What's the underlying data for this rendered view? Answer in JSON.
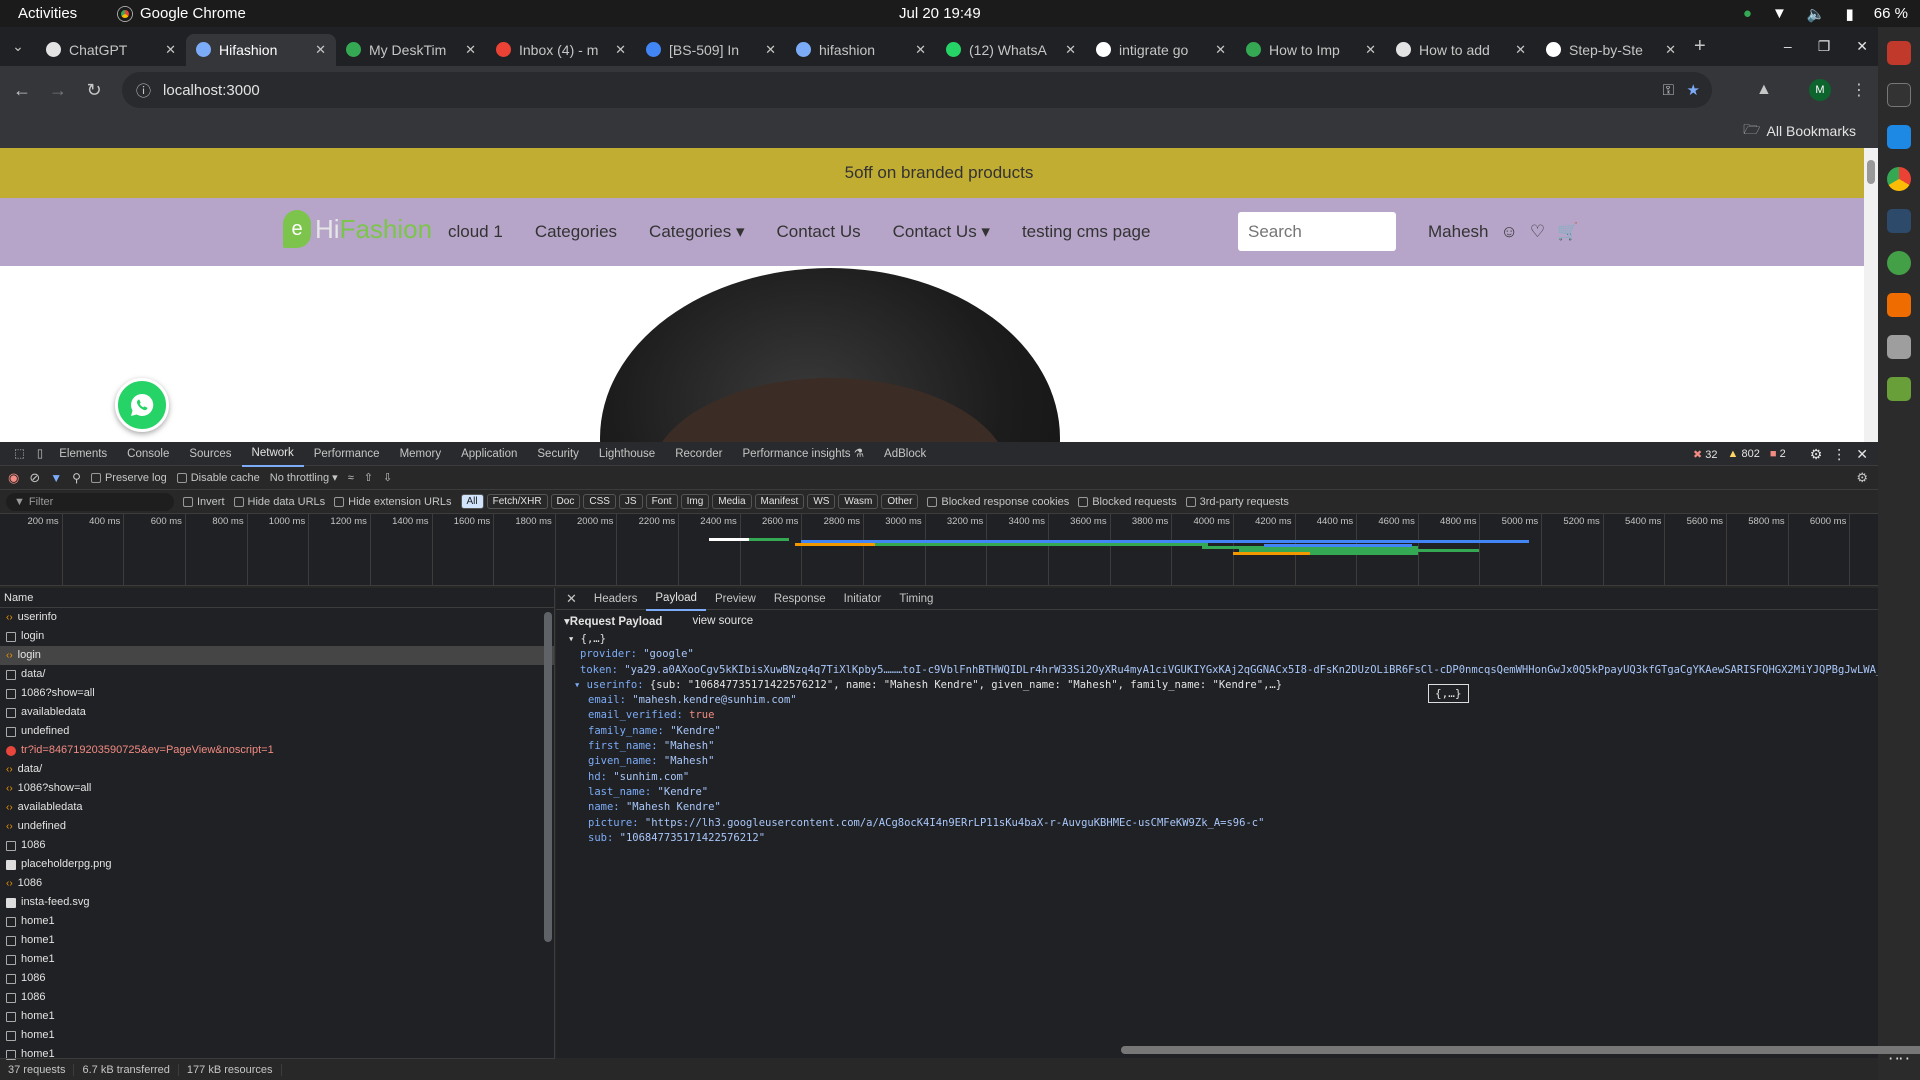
{
  "os": {
    "activities": "Activities",
    "app_name": "Google Chrome",
    "clock": "Jul 20  19:49",
    "battery": "66 %"
  },
  "tabs": [
    {
      "title": "ChatGPT",
      "color": "#e3e3e3"
    },
    {
      "title": "Hifashion",
      "color": "#7cacf8",
      "active": true
    },
    {
      "title": "My DeskTim",
      "color": "#34a853"
    },
    {
      "title": "Inbox (4) - m",
      "color": "#ea4335"
    },
    {
      "title": "[BS-509] In",
      "color": "#4285f4"
    },
    {
      "title": "hifashion",
      "color": "#7cacf8"
    },
    {
      "title": "(12) WhatsA",
      "color": "#25d366"
    },
    {
      "title": "intigrate go",
      "color": "#ffffff"
    },
    {
      "title": "How to Imp",
      "color": "#34a853"
    },
    {
      "title": "How to add",
      "color": "#e3e3e3"
    },
    {
      "title": "Step-by-Ste",
      "color": "#ffffff"
    }
  ],
  "url": "localhost:3000",
  "bookmarks_label": "All Bookmarks",
  "profile_initial": "M",
  "site": {
    "promo": "5off on branded products",
    "logo_hi": "Hi",
    "logo_fashion": "Fashion",
    "logo_e": "e",
    "nav": [
      "cloud 1",
      "Categories",
      "Categories ▾",
      "Contact Us",
      "Contact Us ▾",
      "testing cms page"
    ],
    "search_placeholder": "Search",
    "user_name": "Mahesh"
  },
  "devtools": {
    "tabs": [
      "Elements",
      "Console",
      "Sources",
      "Network",
      "Performance",
      "Memory",
      "Application",
      "Security",
      "Lighthouse",
      "Recorder",
      "Performance insights ⚗",
      "AdBlock"
    ],
    "active_tab": "Network",
    "errors": "32",
    "warnings": "802",
    "issues": "2",
    "toolbar": {
      "preserve_log": "Preserve log",
      "disable_cache": "Disable cache",
      "throttling": "No throttling"
    },
    "filter": {
      "placeholder": "Filter",
      "invert": "Invert",
      "hide_data": "Hide data URLs",
      "hide_ext": "Hide extension URLs",
      "chips": [
        "All",
        "Fetch/XHR",
        "Doc",
        "CSS",
        "JS",
        "Font",
        "Img",
        "Media",
        "Manifest",
        "WS",
        "Wasm",
        "Other"
      ],
      "blocked_cookies": "Blocked response cookies",
      "blocked_requests": "Blocked requests",
      "third_party": "3rd-party requests"
    },
    "timeline_ticks": [
      "200 ms",
      "400 ms",
      "600 ms",
      "800 ms",
      "1000 ms",
      "1200 ms",
      "1400 ms",
      "1600 ms",
      "1800 ms",
      "2000 ms",
      "2200 ms",
      "2400 ms",
      "2600 ms",
      "2800 ms",
      "3000 ms",
      "3200 ms",
      "3400 ms",
      "3600 ms",
      "3800 ms",
      "4000 ms",
      "4200 ms",
      "4400 ms",
      "4600 ms",
      "4800 ms",
      "5000 ms",
      "5200 ms",
      "5400 ms",
      "5600 ms",
      "5800 ms",
      "6000 ms"
    ],
    "name_header": "Name",
    "requests": [
      {
        "name": "userinfo",
        "type": "xhr"
      },
      {
        "name": "login",
        "type": "doc"
      },
      {
        "name": "login",
        "type": "xhr",
        "selected": true
      },
      {
        "name": "data/",
        "type": "doc"
      },
      {
        "name": "1086?show=all",
        "type": "doc"
      },
      {
        "name": "availabledata",
        "type": "doc"
      },
      {
        "name": "undefined",
        "type": "doc"
      },
      {
        "name": "tr?id=846719203590725&ev=PageView&noscript=1",
        "type": "err"
      },
      {
        "name": "data/",
        "type": "xhr"
      },
      {
        "name": "1086?show=all",
        "type": "xhr"
      },
      {
        "name": "availabledata",
        "type": "xhr"
      },
      {
        "name": "undefined",
        "type": "xhr"
      },
      {
        "name": "1086",
        "type": "doc"
      },
      {
        "name": "placeholderpg.png",
        "type": "img"
      },
      {
        "name": "1086",
        "type": "xhr"
      },
      {
        "name": "insta-feed.svg",
        "type": "img"
      },
      {
        "name": "home1",
        "type": "doc"
      },
      {
        "name": "home1",
        "type": "doc"
      },
      {
        "name": "home1",
        "type": "doc"
      },
      {
        "name": "1086",
        "type": "doc"
      },
      {
        "name": "1086",
        "type": "doc"
      },
      {
        "name": "home1",
        "type": "doc"
      },
      {
        "name": "home1",
        "type": "doc"
      },
      {
        "name": "home1",
        "type": "doc"
      }
    ],
    "detail_tabs": [
      "Headers",
      "Payload",
      "Preview",
      "Response",
      "Initiator",
      "Timing"
    ],
    "detail_active": "Payload",
    "payload_title": "▾Request Payload",
    "view_source": "view source",
    "payload": {
      "root": "▾ {,…}",
      "provider_key": "provider:",
      "provider_val": "\"google\"",
      "token_key": "token:",
      "token_val": "\"ya29.a0AXooCgv5kKIbisXuwBNzq4q7TiXlKpby5………toI-c9VblFnhBTHWQIDLr4hrW33Si2OyXRu4myA1ciVGUKIYGxKAj2qGGNACx5I8-dFsKn2DUzOLiBR6FsCl-cDP0nmcqsQemWHHonGwJx0Q5kPpayUQ3kfGTgaCgYKAewSARISFQHGX2MiYJQPBgJwLWA_VjO7Gr",
      "userinfo_key": "▾ userinfo:",
      "userinfo_summary": "{sub: \"106847735171422576212\", name: \"Mahesh Kendre\", given_name: \"Mahesh\", family_name: \"Kendre\",…}",
      "fields": [
        {
          "k": "email:",
          "v": "\"mahesh.kendre@sunhim.com\"",
          "t": "str"
        },
        {
          "k": "email_verified:",
          "v": "true",
          "t": "bool"
        },
        {
          "k": "family_name:",
          "v": "\"Kendre\"",
          "t": "str"
        },
        {
          "k": "first_name:",
          "v": "\"Mahesh\"",
          "t": "str"
        },
        {
          "k": "given_name:",
          "v": "\"Mahesh\"",
          "t": "str"
        },
        {
          "k": "hd:",
          "v": "\"sunhim.com\"",
          "t": "str"
        },
        {
          "k": "last_name:",
          "v": "\"Kendre\"",
          "t": "str"
        },
        {
          "k": "name:",
          "v": "\"Mahesh Kendre\"",
          "t": "str"
        },
        {
          "k": "picture:",
          "v": "\"https://lh3.googleusercontent.com/a/ACg8ocK4I4n9ERrLP11sKu4baX-r-AuvguKBHMEc-usCMFeKW9Zk_A=s96-c\"",
          "t": "str"
        },
        {
          "k": "sub:",
          "v": "\"106847735171422576212\"",
          "t": "str"
        }
      ],
      "tooltip": "{,…}"
    },
    "status": {
      "requests": "37 requests",
      "transferred": "6.7 kB transferred",
      "resources": "177 kB resources"
    }
  }
}
